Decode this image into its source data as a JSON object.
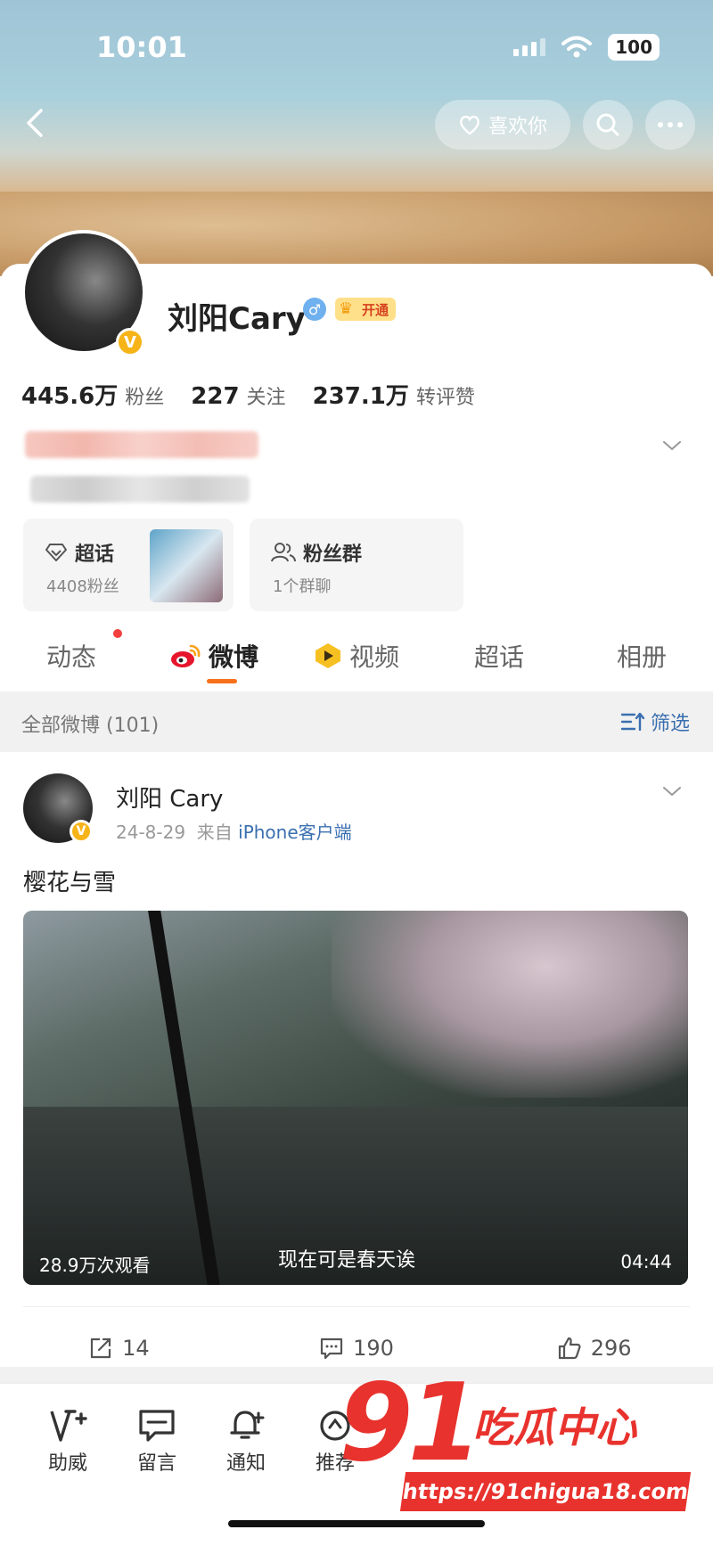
{
  "status_bar": {
    "time": "10:01",
    "battery": "100"
  },
  "header": {
    "like_label": "喜欢你"
  },
  "profile": {
    "name": "刘阳Cary",
    "vip_label": "开通",
    "verified_badge": "V",
    "stats": [
      {
        "num": "445.6万",
        "label": "粉丝"
      },
      {
        "num": "227",
        "label": "关注"
      },
      {
        "num": "237.1万",
        "label": "转评赞"
      }
    ]
  },
  "tiles": {
    "supertopic": {
      "title": "超话",
      "sub": "4408粉丝"
    },
    "fangroup": {
      "title": "粉丝群",
      "sub": "1个群聊"
    }
  },
  "tabs": [
    "动态",
    "微博",
    "视频",
    "超话",
    "相册"
  ],
  "filter": {
    "left": "全部微博 (101)",
    "right": "筛选"
  },
  "post": {
    "name": "刘阳 Cary",
    "date": "24-8-29",
    "from": "来自",
    "source": "iPhone客户端",
    "text": "樱花与雪",
    "video": {
      "views": "28.9万次观看",
      "caption": "现在可是春天诶",
      "duration": "04:44"
    },
    "actions": {
      "repost": "14",
      "comment": "190",
      "like": "296"
    }
  },
  "bottom_bar": [
    "助威",
    "留言",
    "通知",
    "推荐"
  ],
  "watermark": {
    "big": "91",
    "text": "吃瓜中心",
    "url": "https://91chigua18.com"
  },
  "colors": {
    "accent": "#f7711b",
    "link": "#3a6fb0",
    "verified": "#f6b419",
    "watermark": "#e8322d"
  }
}
